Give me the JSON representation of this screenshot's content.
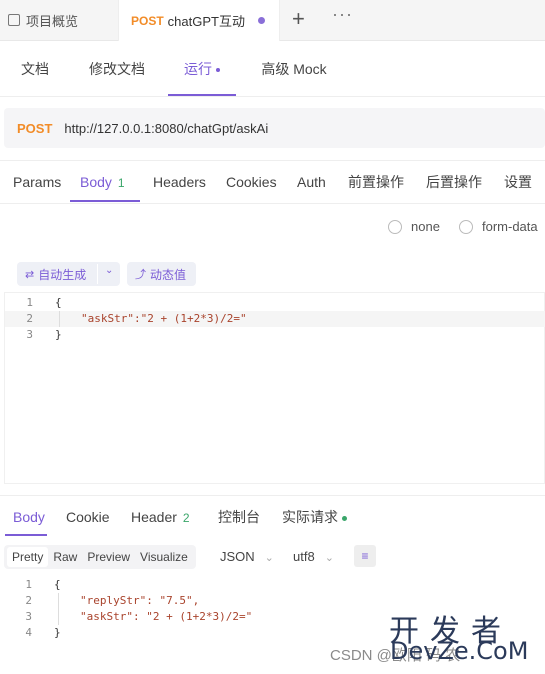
{
  "tabs": {
    "overview": "项目概览",
    "active_method": "POST",
    "active_name": "chatGPT互动",
    "plus": "+",
    "more": "···"
  },
  "doc_tabs": [
    "文档",
    "修改文档",
    "运行",
    "高级 Mock"
  ],
  "url": {
    "method": "POST",
    "address": "http://127.0.0.1:8080/chatGpt/askAi"
  },
  "request_tabs": {
    "params": "Params",
    "body": "Body",
    "body_count": "1",
    "headers": "Headers",
    "cookies": "Cookies",
    "auth": "Auth",
    "pre": "前置操作",
    "post": "后置操作",
    "settings": "设置"
  },
  "body_types": [
    "none",
    "form-data"
  ],
  "gen": {
    "auto": "自动生成",
    "dynamic": "动态值"
  },
  "request_body": {
    "line_numbers": [
      "1",
      "2",
      "3"
    ],
    "lines": [
      "{",
      "\"askStr\":\"2 + (1+2*3)/2=\"",
      "}"
    ]
  },
  "response_tabs": {
    "body": "Body",
    "cookie": "Cookie",
    "header": "Header",
    "header_count": "2",
    "console": "控制台",
    "actual": "实际请求"
  },
  "formats": [
    "Pretty",
    "Raw",
    "Preview",
    "Visualize"
  ],
  "format_select": "JSON",
  "encoding_select": "utf8",
  "response_body": {
    "line_numbers": [
      "1",
      "2",
      "3",
      "4"
    ],
    "lines": [
      "{",
      "\"replyStr\": \"7.5\",",
      "\"askStr\": \"2 + (1+2*3)/2=\"",
      "}"
    ]
  },
  "watermark": {
    "cn": "开发者",
    "en": "DevZe.CoM",
    "csdn": "CSDN @欧阳 码 农"
  },
  "colors": {
    "accent": "#7b5cd6",
    "method": "#f28c28",
    "success": "#3aa66a"
  }
}
